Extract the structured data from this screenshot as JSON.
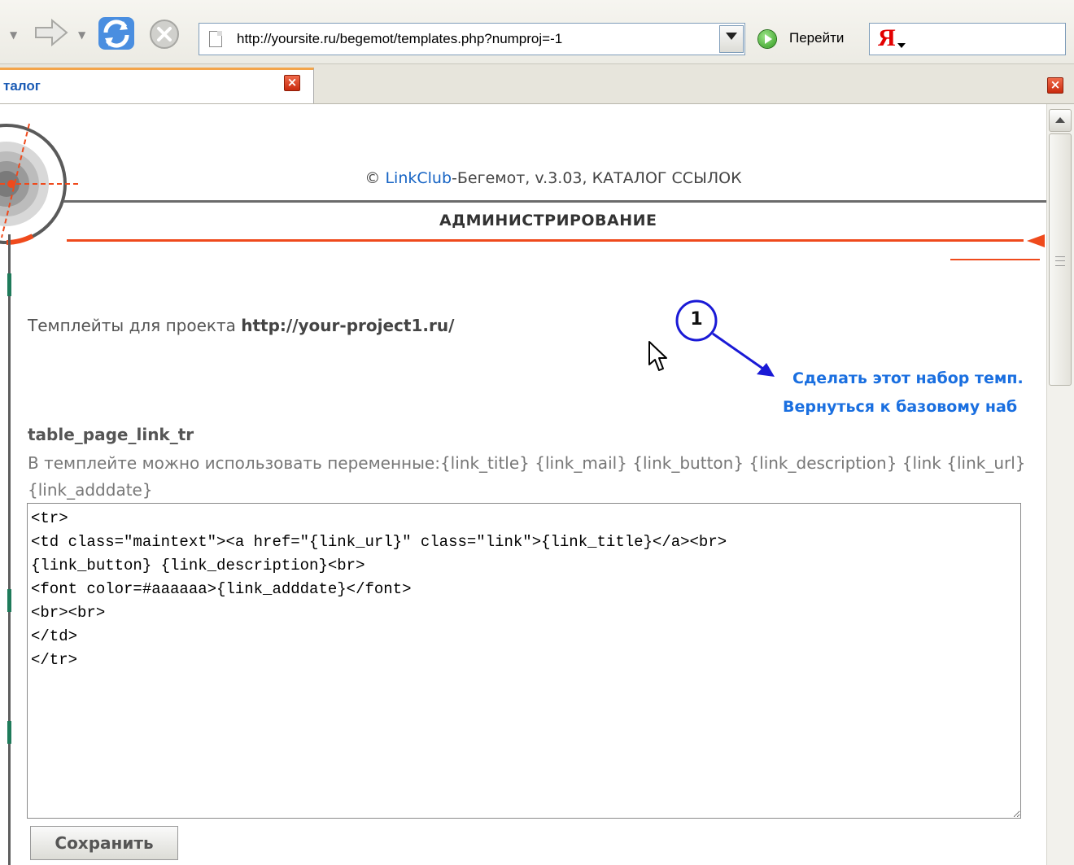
{
  "toolbar": {
    "address_url": "http://yoursite.ru/begemot/templates.php?numproj=-1",
    "go_label": "Перейти",
    "search_logo": "Я",
    "icons": [
      "forward-arrow-icon",
      "refresh-icon",
      "stop-icon",
      "page-icon",
      "go-icon",
      "yandex-logo-icon"
    ]
  },
  "tabs": [
    {
      "label": "талог",
      "active": true
    }
  ],
  "header": {
    "copyright_prefix": "© ",
    "copyright_link": "LinkClub",
    "copyright_rest": "-Бегемот, v.3.03, КАТАЛОГ ССЫЛОК",
    "admin_title": "АДМИНИСТРИРОВАНИЕ"
  },
  "main": {
    "templates_for_label": "Темплейты для проекта ",
    "project_url": "http://your-project1.ru/",
    "annotation_number": "1",
    "make_set_link": "Сделать этот набор темп.",
    "return_base_link": "Вернуться к базовому наб",
    "template_name": "table_page_link_tr",
    "vars_text": "В темплейте можно использовать переменные:{link_title} {link_mail} {link_button} {link_description} {link {link_url} {link_adddate}",
    "template_code": "<tr>\n<td class=\"maintext\"><a href=\"{link_url}\" class=\"link\">{link_title}</a><br>\n{link_button} {link_description}<br>\n<font color=#aaaaaa>{link_adddate}</font>\n<br><br>\n</td>\n</tr>",
    "save_label": "Сохранить"
  },
  "colors": {
    "link_blue": "#1a6fe0",
    "accent_red": "#ef4a1c",
    "annotation_blue": "#1a1ad6"
  }
}
